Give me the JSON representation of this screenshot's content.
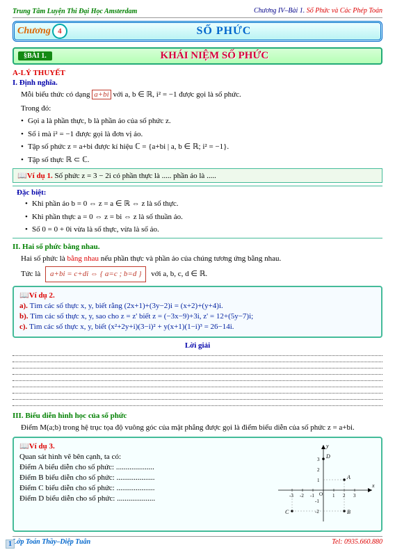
{
  "header": {
    "left": "Trung Tâm Luyện Thi Đại Học Amsterdam",
    "right_chap": "Chương IV–Bài 1.",
    "right_title": "Số Phức và Các Phép Toán"
  },
  "chapter": {
    "word": "hương",
    "num": "4",
    "title": "SỐ PHỨC"
  },
  "lesson": {
    "tag": "§BÀI 1.",
    "title": "KHÁI NIỆM SỐ PHỨC"
  },
  "secA": "A-LÝ THUYẾT",
  "secI": "I. Định nghĩa.",
  "p_intro_a": "Mỗi biểu thức có dạng ",
  "p_intro_box": "a+bi",
  "p_intro_b": " với a, b ∈ ℝ, i² = −1 được gọi là số phức.",
  "p_trongdo": "Trong đó:",
  "b1": "Gọi a là phần thực, b là phần ảo của số phức z.",
  "b2": "Số i mà i² = −1 được gọi là đơn vị ảo.",
  "b3": "Tập số phức z = a+bi được kí hiệu ℂ = {a+bi | a, b ∈ ℝ; i² = −1}.",
  "b4": "Tập số thực ℝ ⊂ ℂ.",
  "ex1_title": "Ví dụ 1.",
  "ex1_body": " Số phức z = 3 − 2i có phần thực là ..... phần ảo là .....",
  "dacbiet": "Đặc biệt:",
  "db1": "Khi phần ảo b = 0 ⇔ z = a ∈ ℝ ⇔ z là số thực.",
  "db2": "Khi phần thực a = 0 ⇔ z = bi ⇔ z là số thuần ảo.",
  "db3": "Số 0 = 0 + 0i vừa là số thực, vừa là số ảo.",
  "secII": "II. Hai số phức bằng nhau.",
  "p2_a": "Hai số phức là ",
  "p2_b": "bằng nhau",
  "p2_c": " nếu phần thực và phần ảo của chúng tương ứng bằng nhau.",
  "p2_tuc": "Tức là",
  "p2_box": "a+bi = c+di ⇔ { a=c ; b=d }",
  "p2_with": " với a, b, c, d ∈ ℝ.",
  "ex2_title": "Ví dụ 2.",
  "ex2_a": "Tìm các số thực x, y, biết rằng (2x+1)+(3y−2)i = (x+2)+(y+4)i.",
  "ex2_b": "Tìm các số thực x, y, sao cho z = z' biết z = (−3x−9)+3i, z' = 12+(5y−7)i;",
  "ex2_c": "Tìm các số thực x, y, biết (x²+2y+i)(3−i)² + y(x+1)(1−i)³ = 26−14i.",
  "loigiai": "Lời giải",
  "secIII": "III. Biểu diễn hình học của số phức",
  "p3": "Điểm M(a;b) trong hệ trục tọa độ vuông góc của mặt phẳng được gọi là điểm biểu diễn của số phức z = a+bi.",
  "ex3_title": "Ví dụ 3.",
  "ex3_intro": "Quan sát hình vẽ bên cạnh, ta có:",
  "ex3_A": "Điểm A biểu diễn cho số phức: ....................",
  "ex3_B": "Điểm B biểu diễn cho số phức: ....................",
  "ex3_C": "Điểm C biểu diễn cho số phức: ....................",
  "ex3_D": "Điểm D biểu diễn cho số phức: ....................",
  "footer": {
    "left": "Lớp Toán Thầy–Diệp Tuân",
    "right": "Tel: 0935.660.880",
    "page": "1"
  },
  "chart_data": {
    "type": "scatter",
    "title": "",
    "xlabel": "x",
    "ylabel": "y",
    "xlim": [
      -3.5,
      3.5
    ],
    "ylim": [
      -3,
      3.5
    ],
    "series": [
      {
        "name": "A",
        "x": 2,
        "y": 1
      },
      {
        "name": "B",
        "x": 2,
        "y": -2
      },
      {
        "name": "C",
        "x": -3,
        "y": -2
      },
      {
        "name": "D",
        "x": 0,
        "y": 3
      }
    ],
    "xticks": [
      -3,
      -2,
      -1,
      0,
      1,
      2,
      3
    ],
    "yticks": [
      -2,
      -1,
      1,
      2,
      3
    ]
  }
}
